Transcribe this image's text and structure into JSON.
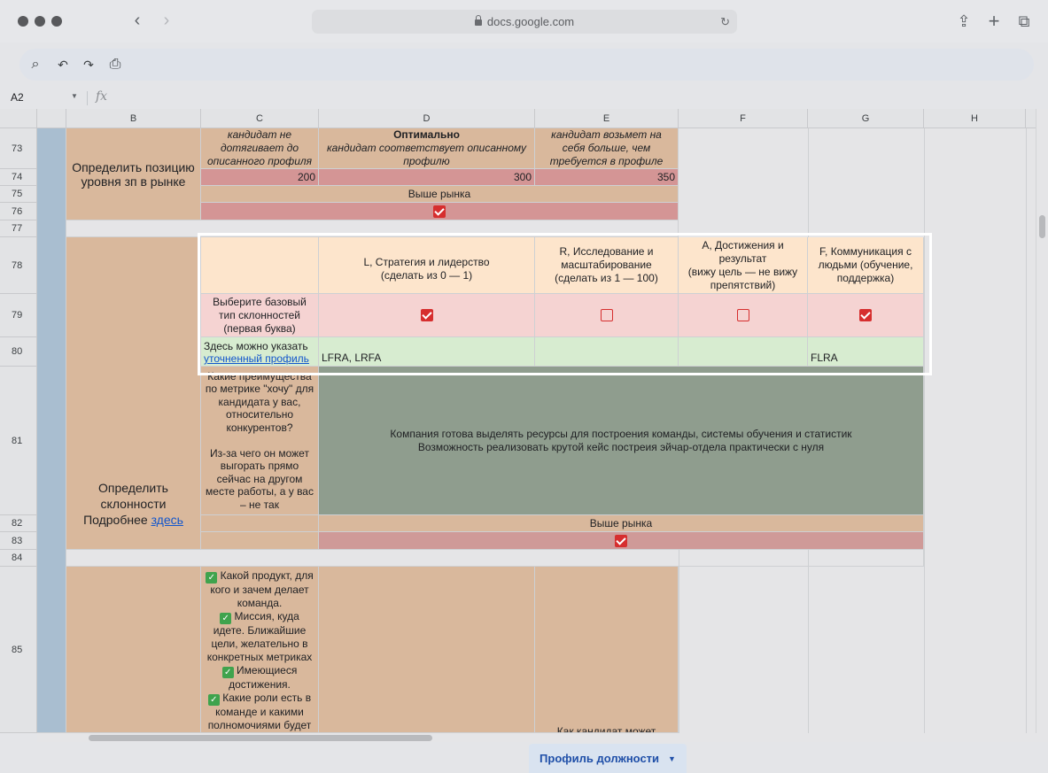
{
  "browser": {
    "url": "docs.google.com",
    "back_glyph": "‹",
    "forward_glyph": "›",
    "reload_glyph": "↻",
    "share_glyph": "⇪",
    "new_tab_glyph": "+",
    "tabs_glyph": "⧉"
  },
  "toolbar": {
    "search_glyph": "⌕",
    "undo_glyph": "↶",
    "redo_glyph": "↷",
    "print_glyph": "⎙"
  },
  "formula_bar": {
    "cell_ref": "A2",
    "fx": "fx",
    "caret": "▼"
  },
  "columns": [
    "B",
    "C",
    "D",
    "E",
    "F",
    "G",
    "H"
  ],
  "rows": {
    "r73": "73",
    "r74": "74",
    "r75": "75",
    "r76": "76",
    "r77": "77",
    "r78": "78",
    "r79": "79",
    "r80": "80",
    "r81": "81",
    "r82": "82",
    "r83": "83",
    "r84": "84",
    "r85": "85"
  },
  "salary": {
    "label": "Определить позицию уровня зп в рынке",
    "c73": "кандидат не дотягивает до описанного профиля",
    "d73_title": "Оптимально",
    "d73_text": "кандидат соответствует описанному профилю",
    "e73": "кандидат возьмет на себя больше, чем требуется в профиле",
    "c74": "200",
    "d74": "300",
    "e74": "350",
    "market": "Выше рынка"
  },
  "inclinations": {
    "label_line1": "Определить",
    "label_line2": "склонности",
    "label_more": "Подробнее",
    "label_link": "здесь",
    "d78": "L, Стратегия и лидерство\n(сделать из 0 — 1)",
    "e78": "R, Исследование и масштабирование\n(сделать из 1 — 100)",
    "f78": "A, Достижения и результат\n(вижу цель — не вижу препятствий)",
    "g78": "F, Коммуникация с людьми (обучение, поддержка)",
    "c79": "Выберите базовый тип склонностей (первая буква)",
    "checks": [
      true,
      false,
      false,
      true
    ],
    "c80_text": "Здесь можно указать",
    "c80_link": "уточненный профиль",
    "d80": "LFRA, LRFA",
    "g80": "FLRA",
    "c81": "Какие преимущества по метрике \"хочу\" для кандидата у вас, относительно конкурентов?\n\nИз-за чего он может выгорать прямо сейчас на другом месте работы, а у вас – не так",
    "d81": "Компания готова выделять ресурсы для построения команды, системы обучения и статистик\nВозможность реализовать крутой кейс постреия эйчар-отдела практически с нуля",
    "market": "Выше рынка"
  },
  "row85": {
    "items": [
      "Какой продукт, для кого и зачем делает команда.",
      "Миссия, куда идете. Ближайшие цели, желательно в конкретных метриках",
      "Имеющиеся достижения.",
      "Какие роли есть в команде и какими полномочиями будет обладать данная"
    ],
    "check_glyph": "✓",
    "e85": "Как кандидат может"
  },
  "sheet_tab": {
    "label": "Профиль должности",
    "caret": "▼"
  },
  "colors": {
    "tan": "#d9b89c",
    "rose": "#d49595",
    "dark_green": "#8f9d8e",
    "peach": "#fde5cc",
    "pink": "#f5d3d2",
    "mint": "#d7ecd0",
    "checkbox": "#d62e2e",
    "link": "#1155cc"
  }
}
